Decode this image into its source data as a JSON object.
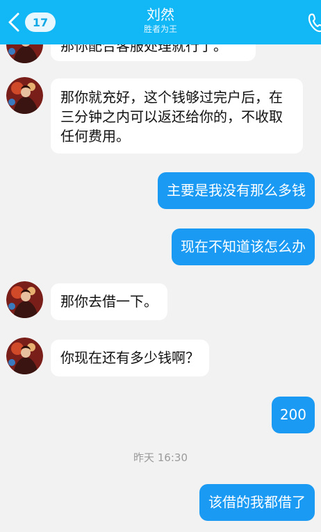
{
  "header": {
    "back_count": "17",
    "title": "刘然",
    "subtitle": "胜者为王",
    "colors": {
      "bar": "#12b7f5",
      "bubble_out": "#1a9af2"
    }
  },
  "messages": [
    {
      "from": "them",
      "text": "那你配合客服处理就行了。"
    },
    {
      "from": "them",
      "text": "那你就充好，这个钱够过完户后，在三分钟之内可以返还给你的，不收取任何费用。"
    },
    {
      "from": "me",
      "text": "主要是我没有那么多钱"
    },
    {
      "from": "me",
      "text": "现在不知道该怎么办"
    },
    {
      "from": "them",
      "text": "那你去借一下。"
    },
    {
      "from": "them",
      "text": "你现在还有多少钱啊？"
    },
    {
      "from": "me",
      "text": "200"
    },
    {
      "from": "me",
      "text": "该借的我都借了"
    }
  ],
  "timestamp": "昨天 16:30"
}
